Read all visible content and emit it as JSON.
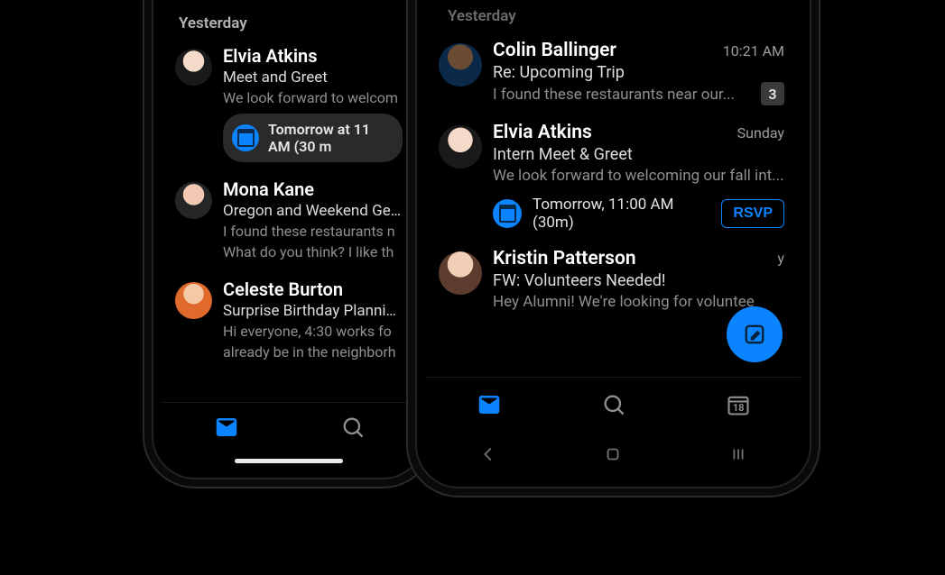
{
  "left_phone": {
    "section_label": "Yesterday",
    "items": [
      {
        "sender": "Elvia Atkins",
        "subject": "Meet and Greet",
        "preview": "We look forward to welcom",
        "event_chip": "Tomorrow at 11 AM (30 m"
      },
      {
        "sender": "Mona Kane",
        "subject": "Oregon and Weekend Geta",
        "preview1": "I found these restaurants n",
        "preview2": "What do you think? I like th"
      },
      {
        "sender": "Celeste Burton",
        "subject": "Surprise Birthday Planning",
        "preview1": "Hi everyone, 4:30 works fo",
        "preview2": "already be in the neighborh"
      }
    ],
    "tabs": {
      "mail": "mail-icon",
      "search": "search-icon",
      "calendar": "calendar-icon"
    }
  },
  "right_phone": {
    "section_label": "Yesterday",
    "items": [
      {
        "sender": "Colin Ballinger",
        "time": "10:21 AM",
        "subject": "Re: Upcoming Trip",
        "preview": "I found these restaurants near our...",
        "count": "3"
      },
      {
        "sender": "Elvia Atkins",
        "time": "Sunday",
        "subject": "Intern Meet & Greet",
        "preview": "We look forward to welcoming our fall int...",
        "event_text": "Tomorrow, 11:00 AM (30m)",
        "rsvp": "RSVP"
      },
      {
        "sender": "Kristin Patterson",
        "time": "y",
        "subject": "FW: Volunteers Needed!",
        "preview": "Hey Alumni! We're looking for voluntee"
      }
    ],
    "tabs": {
      "mail": "mail-icon",
      "search": "search-icon",
      "calendar_day": "18"
    },
    "compose": "compose"
  }
}
